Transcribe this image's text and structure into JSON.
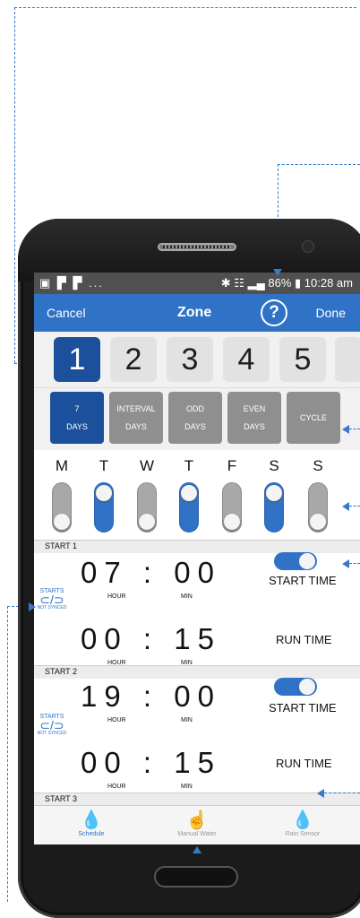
{
  "status": {
    "left_icons": "▣ ▛ ▛ ...",
    "right": "✱ ☷ ▂▄ 86% ▮ 10:28 am"
  },
  "nav": {
    "cancel": "Cancel",
    "title": "Zone",
    "help": "?",
    "done": "Done"
  },
  "zones": [
    "1",
    "2",
    "3",
    "4",
    "5"
  ],
  "modes": [
    {
      "line1": "7",
      "line2": "DAYS"
    },
    {
      "line1": "INTERVAL",
      "line2": "DAYS"
    },
    {
      "line1": "ODD",
      "line2": "DAYS"
    },
    {
      "line1": "EVEN",
      "line2": "DAYS"
    },
    {
      "line1": "CYCLE",
      "line2": ""
    }
  ],
  "days": [
    "M",
    "T",
    "W",
    "T",
    "F",
    "S",
    "S"
  ],
  "days_on": [
    false,
    true,
    false,
    true,
    false,
    true,
    false
  ],
  "starts": [
    {
      "label": "START 1",
      "start_time": "07 : 00",
      "run_time": "00 : 15",
      "start_label": "START TIME",
      "run_label": "RUN TIME",
      "hour": "HOUR",
      "min": "MIN"
    },
    {
      "label": "START 2",
      "start_time": "19 : 00",
      "run_time": "00 : 15",
      "start_label": "START TIME",
      "run_label": "RUN TIME",
      "hour": "HOUR",
      "min": "MIN"
    },
    {
      "label": "START 3"
    }
  ],
  "sync": {
    "starts": "STARTS",
    "glyph": "⊂/⊃",
    "not_synced": "NOT SYNCED"
  },
  "tabs": [
    {
      "label": "Schedule",
      "icon": "water-drops-icon",
      "glyph": "💧"
    },
    {
      "label": "Manual Water",
      "icon": "hand-pointer-icon",
      "glyph": "☝"
    },
    {
      "label": "Rain Sensor",
      "icon": "rain-drops-icon",
      "glyph": "💧"
    }
  ],
  "colors": {
    "accent": "#2f72c6",
    "active_dark": "#1c4f9c",
    "annotation": "#3a78c8"
  }
}
